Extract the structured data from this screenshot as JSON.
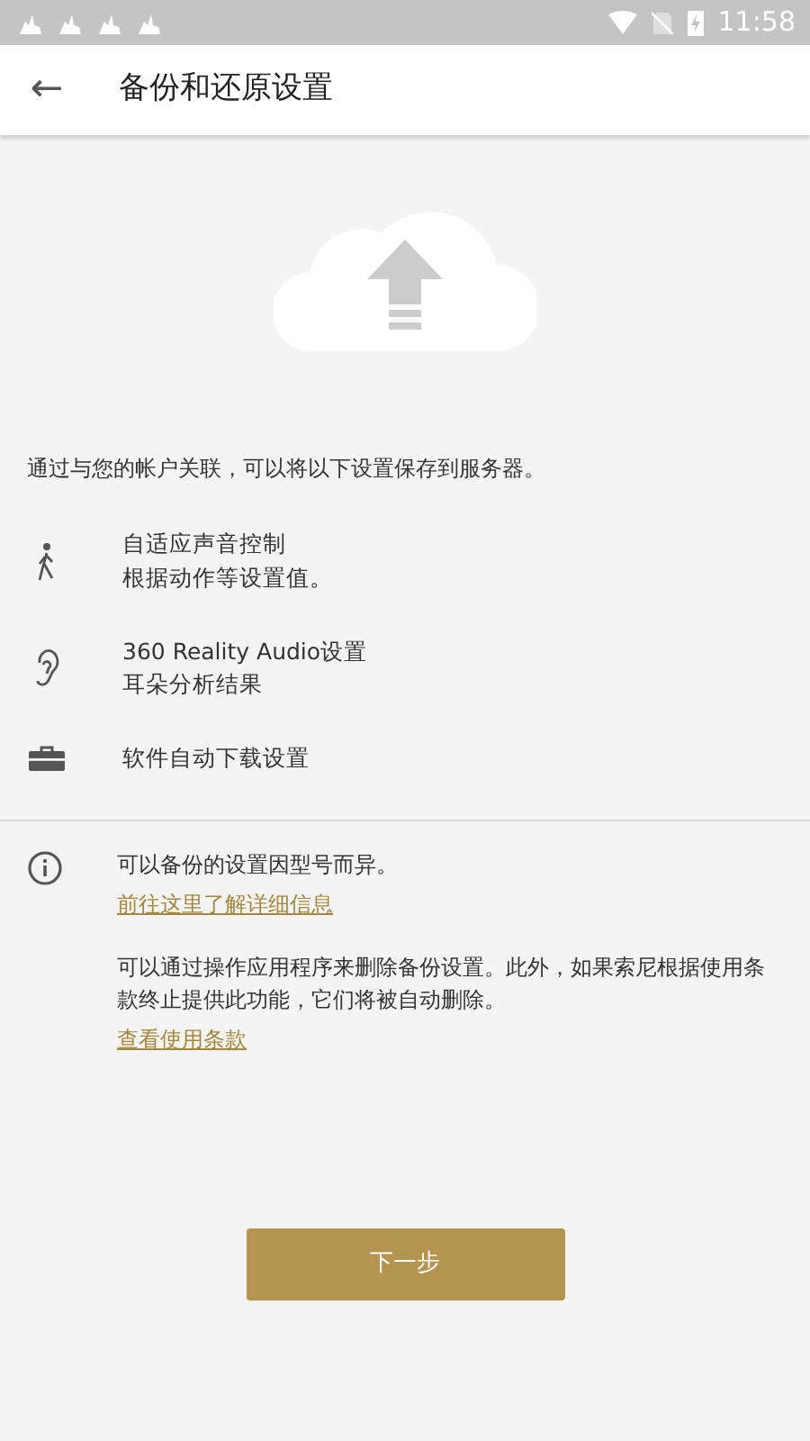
{
  "status_bar": {
    "notifications": [
      {
        "kind": "app"
      },
      {
        "kind": "app"
      },
      {
        "kind": "app"
      },
      {
        "kind": "app"
      }
    ],
    "time": "11:58"
  },
  "header": {
    "back": "←",
    "title": "备份和还原设置"
  },
  "intro": "通过与您的帐户关联，可以将以下设置保存到服务器。",
  "items": [
    {
      "kind": "walk",
      "title": "自适应声音控制",
      "subtitle": "根据动作等设置值。"
    },
    {
      "kind": "ear",
      "title": "360 Reality Audio设置",
      "subtitle": "耳朵分析结果"
    },
    {
      "kind": "toolbox",
      "title": "软件自动下载设置"
    }
  ],
  "notes": [
    {
      "text": "可以备份的设置因型号而异。",
      "link": "前往这里了解详细信息"
    },
    {
      "text": "可以通过操作应用程序来删除备份设置。此外，如果索尼根据使用条款终止提供此功能，它们将被自动删除。",
      "link": "查看使用条款"
    }
  ],
  "button": "下一步"
}
